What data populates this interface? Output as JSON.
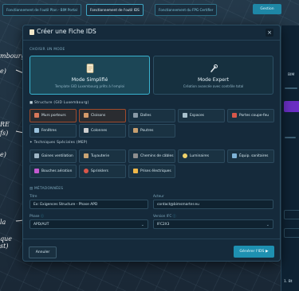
{
  "top_tabs": [
    "Fonctionnement de l'outil Plan - BIM Portal",
    "Fonctionnement de l'outil IDS",
    "Fonctionnement du FPG Certifier"
  ],
  "top_button": "Gestion",
  "annotations": [
    "mbourg)",
    "e)",
    "RE",
    "fs)",
    "e)",
    "la",
    "que",
    "st)"
  ],
  "right_panel": {
    "label": "BIM",
    "step_label": "1. Bt"
  },
  "modal": {
    "title": "Créer une Fiche IDS",
    "close_label": "×",
    "mode_section": "CHOISIR UN MODE",
    "modes": [
      {
        "title": "Mode Simplifié",
        "subtitle": "Template GID Luxembourg prêts à l'emploi",
        "icon": "document-icon",
        "selected": true
      },
      {
        "title": "Mode Expert",
        "subtitle": "Création avancée avec contrôle total",
        "icon": "wrench-icon",
        "selected": false
      }
    ],
    "structure_section": "Structure (GID Luxembourg)",
    "structure_items": [
      {
        "label": "Murs porteurs",
        "selected": true,
        "color": "#d9785a"
      },
      {
        "label": "Cloisons",
        "selected": true,
        "color": "#d39a6a"
      },
      {
        "label": "Dalles",
        "selected": false,
        "color": "#8a9aa6"
      },
      {
        "label": "Espaces",
        "selected": false,
        "color": "#a8c0cc"
      },
      {
        "label": "Portes coupe-feu",
        "selected": false,
        "color": "#d8574a"
      },
      {
        "label": "Fenêtres",
        "selected": false,
        "color": "#9bc3de"
      },
      {
        "label": "Colonnes",
        "selected": false,
        "color": "#cfcfcf"
      },
      {
        "label": "Poutres",
        "selected": false,
        "color": "#c8a070"
      }
    ],
    "mep_section": "Techniques Spéciales (MEP)",
    "mep_items": [
      {
        "label": "Gaines ventilation",
        "color": "#9fb7c6"
      },
      {
        "label": "Tuyauterie",
        "color": "#c9a474"
      },
      {
        "label": "Chemins de câbles",
        "color": "#8e8e8e"
      },
      {
        "label": "Luminaires",
        "color": "#f0d26a"
      },
      {
        "label": "Équip. sanitaires",
        "color": "#7fb3d6"
      },
      {
        "label": "Bouches aération",
        "color": "#c45ad0"
      },
      {
        "label": "Sprinklers",
        "color": "#d9574a"
      },
      {
        "label": "Prises électriques",
        "color": "#f0b84a"
      }
    ],
    "meta_section": "MÉTADONNÉES",
    "fields": {
      "title_label": "Titre",
      "title_value": "Ex: Exigences Structure - Phase APD",
      "actor_label": "Acteur",
      "actor_value": "contact@bimsmarter.eu",
      "phase_label": "Phase",
      "phase_value": "APD/AUT",
      "ifc_label": "Version IFC",
      "ifc_value": "IFC2X3"
    },
    "cancel_label": "Annuler",
    "generate_label": "Générer l'IDS ▶"
  },
  "colors": {
    "accent": "#1e90b1",
    "selected_border": "#39b3cf",
    "bg": "#152a3b"
  }
}
